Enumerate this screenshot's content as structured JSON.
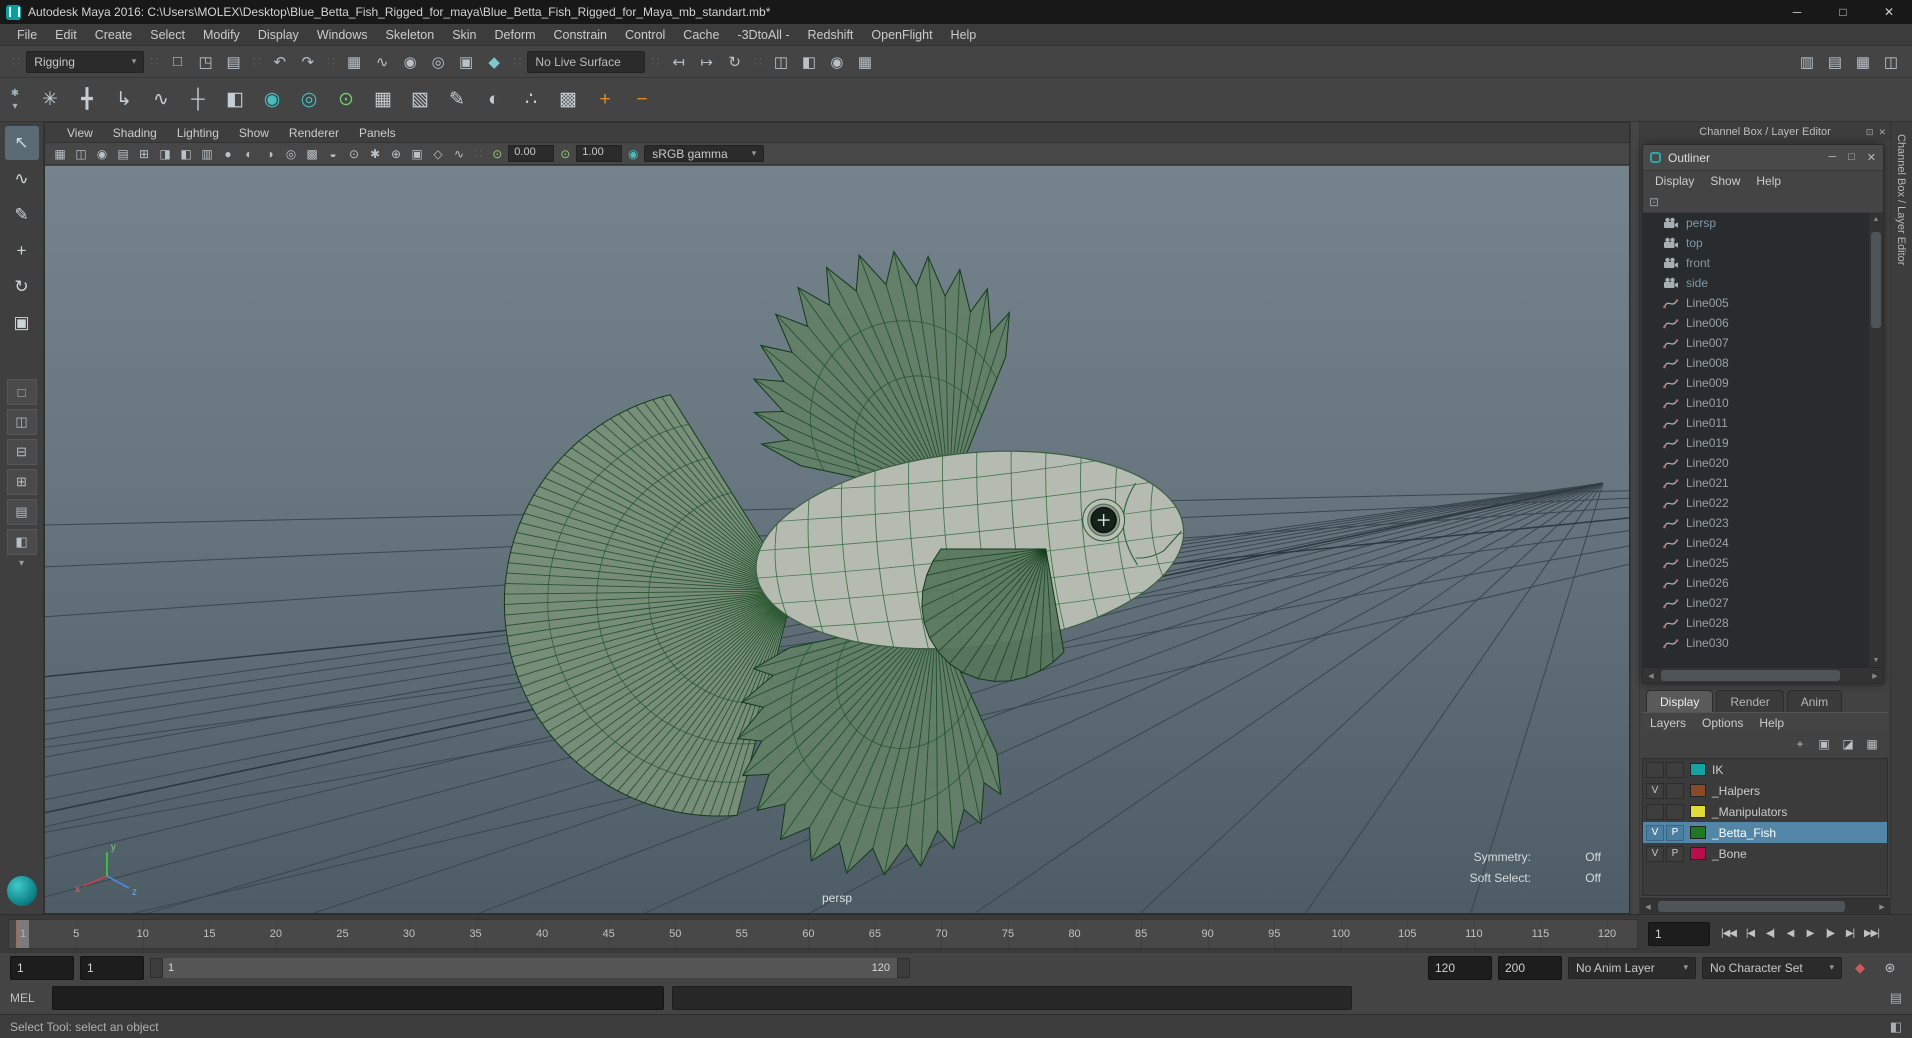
{
  "window": {
    "title": "Autodesk Maya 2016: C:\\Users\\MOLEX\\Desktop\\Blue_Betta_Fish_Rigged_for_maya\\Blue_Betta_Fish_Rigged_for_Maya_mb_standart.mb*",
    "controls": {
      "minimize": "─",
      "maximize": "□",
      "close": "✕"
    }
  },
  "menu_bar": [
    "File",
    "Edit",
    "Create",
    "Select",
    "Modify",
    "Display",
    "Windows",
    "Skeleton",
    "Skin",
    "Deform",
    "Constrain",
    "Control",
    "Cache",
    "-3DtoAll -",
    "Redshift",
    "OpenFlight",
    "Help"
  ],
  "status_line": {
    "menu_set": "Rigging",
    "live_surface": "No Live Surface",
    "file_icons": [
      "new-scene-icon",
      "open-scene-icon",
      "save-scene-icon"
    ],
    "undo_icons": [
      "undo-icon",
      "redo-icon"
    ],
    "snap_icons": [
      "snap-grid-icon",
      "snap-curve-icon",
      "snap-point-icon",
      "snap-projected-center-icon",
      "snap-view-plane-icon",
      "make-live-icon"
    ],
    "history_icons": [
      "input-connections-icon",
      "output-connections-icon",
      "construction-history-icon"
    ],
    "render_icons": [
      "open-render-view-icon",
      "render-current-frame-icon",
      "ipr-render-icon",
      "render-settings-icon"
    ],
    "sidebar_icons": [
      "attribute-editor-toggle-icon",
      "tool-settings-toggle-icon",
      "channel-box-toggle-icon",
      "panel-layout-icon"
    ]
  },
  "shelf": {
    "icons": [
      "snowflake-icon",
      "joint-tool-icon",
      "ik-handle-icon",
      "ik-spline-icon",
      "insert-joint-icon",
      "mirror-joint-icon",
      "hik-character-icon",
      "hik-skeleton-icon",
      "hik-control-icon",
      "bind-skin-icon",
      "detach-skin-icon",
      "paint-weights-icon",
      "blendshape-icon",
      "cluster-icon",
      "lattice-icon",
      "add-influence-icon",
      "remove-influence-icon"
    ]
  },
  "toolbox": {
    "tools": [
      "select-tool",
      "lasso-tool",
      "paint-select-tool",
      "move-tool",
      "rotate-tool",
      "scale-tool"
    ],
    "layouts": [
      "single-pane",
      "two-pane-side",
      "two-pane-stacked",
      "four-pane",
      "three-pane-split",
      "custom-pane"
    ]
  },
  "viewport": {
    "panel_menus": [
      "View",
      "Shading",
      "Lighting",
      "Show",
      "Renderer",
      "Panels"
    ],
    "toolbar_icons": [
      "select-camera-icon",
      "lock-camera-icon",
      "camera-attributes-icon",
      "bookmarks-icon",
      "image-plane-icon",
      "view-grid-icon",
      "film-gate-icon",
      "resolution-gate-icon",
      "gate-mask-icon",
      "field-chart-icon",
      "safe-action-icon",
      "safe-title-icon",
      "isolate-select-icon",
      "wireframe-icon",
      "shaded-icon",
      "textured-icon",
      "lights-icon",
      "shadows-icon",
      "screen-space-ao-icon",
      "multisample-icon"
    ],
    "exposure": "0.00",
    "gamma": "1.00",
    "view_transform": "sRGB gamma",
    "camera_label": "persp",
    "overlay": {
      "symmetry_label": "Symmetry:",
      "symmetry_value": "Off",
      "soft_select_label": "Soft Select:",
      "soft_select_value": "Off"
    }
  },
  "right_panel": {
    "header": "Channel Box / Layer Editor",
    "vertical_tab": "Channel Box / Layer Editor",
    "outliner": {
      "title": "Outliner",
      "menus": [
        "Display",
        "Show",
        "Help"
      ],
      "items": [
        {
          "name": "persp",
          "type": "camera"
        },
        {
          "name": "top",
          "type": "camera"
        },
        {
          "name": "front",
          "type": "camera"
        },
        {
          "name": "side",
          "type": "camera"
        },
        {
          "name": "Line005",
          "type": "curve"
        },
        {
          "name": "Line006",
          "type": "curve"
        },
        {
          "name": "Line007",
          "type": "curve"
        },
        {
          "name": "Line008",
          "type": "curve"
        },
        {
          "name": "Line009",
          "type": "curve"
        },
        {
          "name": "Line010",
          "type": "curve"
        },
        {
          "name": "Line011",
          "type": "curve"
        },
        {
          "name": "Line019",
          "type": "curve"
        },
        {
          "name": "Line020",
          "type": "curve"
        },
        {
          "name": "Line021",
          "type": "curve"
        },
        {
          "name": "Line022",
          "type": "curve"
        },
        {
          "name": "Line023",
          "type": "curve"
        },
        {
          "name": "Line024",
          "type": "curve"
        },
        {
          "name": "Line025",
          "type": "curve"
        },
        {
          "name": "Line026",
          "type": "curve"
        },
        {
          "name": "Line027",
          "type": "curve"
        },
        {
          "name": "Line028",
          "type": "curve"
        },
        {
          "name": "Line030",
          "type": "curve"
        }
      ]
    },
    "layer_editor": {
      "tabs": [
        "Display",
        "Render",
        "Anim"
      ],
      "active_tab": "Display",
      "menus": [
        "Layers",
        "Options",
        "Help"
      ],
      "icon_row": [
        "create-empty-layer-icon",
        "create-layer-from-selected-icon",
        "create-override-layer-icon",
        "layer-options-icon"
      ],
      "layers": [
        {
          "v": "",
          "p": "",
          "color": "#17a2a2",
          "name": "IK",
          "selected": false
        },
        {
          "v": "V",
          "p": "",
          "color": "#8a4a28",
          "name": "_Halpers",
          "selected": false
        },
        {
          "v": "",
          "p": "",
          "color": "#e0da3c",
          "name": "_Manipulators",
          "selected": false
        },
        {
          "v": "V",
          "p": "P",
          "color": "#1e7a22",
          "name": "_Betta_Fish",
          "selected": true
        },
        {
          "v": "V",
          "p": "P",
          "color": "#b5104d",
          "name": "_Bone",
          "selected": false
        }
      ]
    }
  },
  "timeline": {
    "ticks": [
      1,
      5,
      10,
      15,
      20,
      25,
      30,
      35,
      40,
      45,
      50,
      55,
      60,
      65,
      70,
      75,
      80,
      85,
      90,
      95,
      100,
      105,
      110,
      115,
      120
    ],
    "current_frame": 1,
    "frame_field": "1",
    "playback": [
      "go-to-start",
      "step-back-frame",
      "step-back-key",
      "play-backwards",
      "play-forwards",
      "step-forward-key",
      "step-forward-frame",
      "go-to-end"
    ]
  },
  "range_slider": {
    "anim_start": "1",
    "playback_start": "1",
    "range_start_label": "1",
    "range_end_label": "120",
    "playback_end": "120",
    "anim_end": "200",
    "anim_layer": "No Anim Layer",
    "character_set": "No Character Set",
    "icons": [
      "auto-keyframe-icon",
      "animation-preferences-icon"
    ]
  },
  "command_line": {
    "label": "MEL"
  },
  "help_line": {
    "text": "Select Tool: select an object"
  },
  "colors": {
    "accent": "#5285a6",
    "wire_green": "#1d5229"
  }
}
